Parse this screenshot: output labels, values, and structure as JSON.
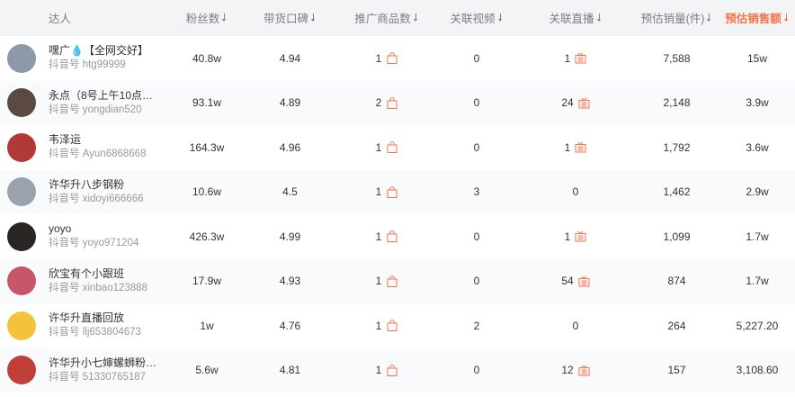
{
  "header": {
    "user": "达人",
    "fans": "粉丝数",
    "reputation": "带货口碑",
    "products": "推广商品数",
    "videos": "关联视频",
    "lives": "关联直播",
    "sales": "预估销量(件)",
    "amount": "预估销售额"
  },
  "colors": {
    "accent": "#f5734b",
    "header_bg": "#f3f4f6",
    "muted": "#999999"
  },
  "id_prefix": "抖音号",
  "rows": [
    {
      "nick": "嘿广💧【全网交好】",
      "dyid": "htg99999",
      "fans": "40.8w",
      "rep": "4.94",
      "prod": "1",
      "video": "0",
      "live": "1",
      "live_icon": true,
      "sales": "7,588",
      "amount": "15w",
      "avatar": "#8c9aa8"
    },
    {
      "nick": "永点（8号上午10点儿…",
      "dyid": "yongdian520",
      "fans": "93.1w",
      "rep": "4.89",
      "prod": "2",
      "video": "0",
      "live": "24",
      "live_icon": true,
      "sales": "2,148",
      "amount": "3.9w",
      "avatar": "#5b4a42"
    },
    {
      "nick": "韦泽运",
      "dyid": "Ayun6868668",
      "fans": "164.3w",
      "rep": "4.96",
      "prod": "1",
      "video": "0",
      "live": "1",
      "live_icon": true,
      "sales": "1,792",
      "amount": "3.6w",
      "avatar": "#b23a36"
    },
    {
      "nick": "许华升八步钢粉",
      "dyid": "xidoyi666666",
      "fans": "10.6w",
      "rep": "4.5",
      "prod": "1",
      "video": "3",
      "live": "0",
      "live_icon": false,
      "sales": "1,462",
      "amount": "2.9w",
      "avatar": "#9aa3ad"
    },
    {
      "nick": "yoyo",
      "dyid": "yoyo971204",
      "fans": "426.3w",
      "rep": "4.99",
      "prod": "1",
      "video": "0",
      "live": "1",
      "live_icon": true,
      "sales": "1,099",
      "amount": "1.7w",
      "avatar": "#2a2522"
    },
    {
      "nick": "欣宝有个小跟班",
      "dyid": "xinbao123888",
      "fans": "17.9w",
      "rep": "4.93",
      "prod": "1",
      "video": "0",
      "live": "54",
      "live_icon": true,
      "sales": "874",
      "amount": "1.7w",
      "avatar": "#c7566a"
    },
    {
      "nick": "许华升直播回放",
      "dyid": "llj653804673",
      "fans": "1w",
      "rep": "4.76",
      "prod": "1",
      "video": "2",
      "live": "0",
      "live_icon": false,
      "sales": "264",
      "amount": "5,227.20",
      "avatar": "#f5c33b"
    },
    {
      "nick": "许华升小七婶螺蛳粉小麦",
      "dyid": "51330765187",
      "fans": "5.6w",
      "rep": "4.81",
      "prod": "1",
      "video": "0",
      "live": "12",
      "live_icon": true,
      "sales": "157",
      "amount": "3,108.60",
      "avatar": "#c04038"
    }
  ]
}
